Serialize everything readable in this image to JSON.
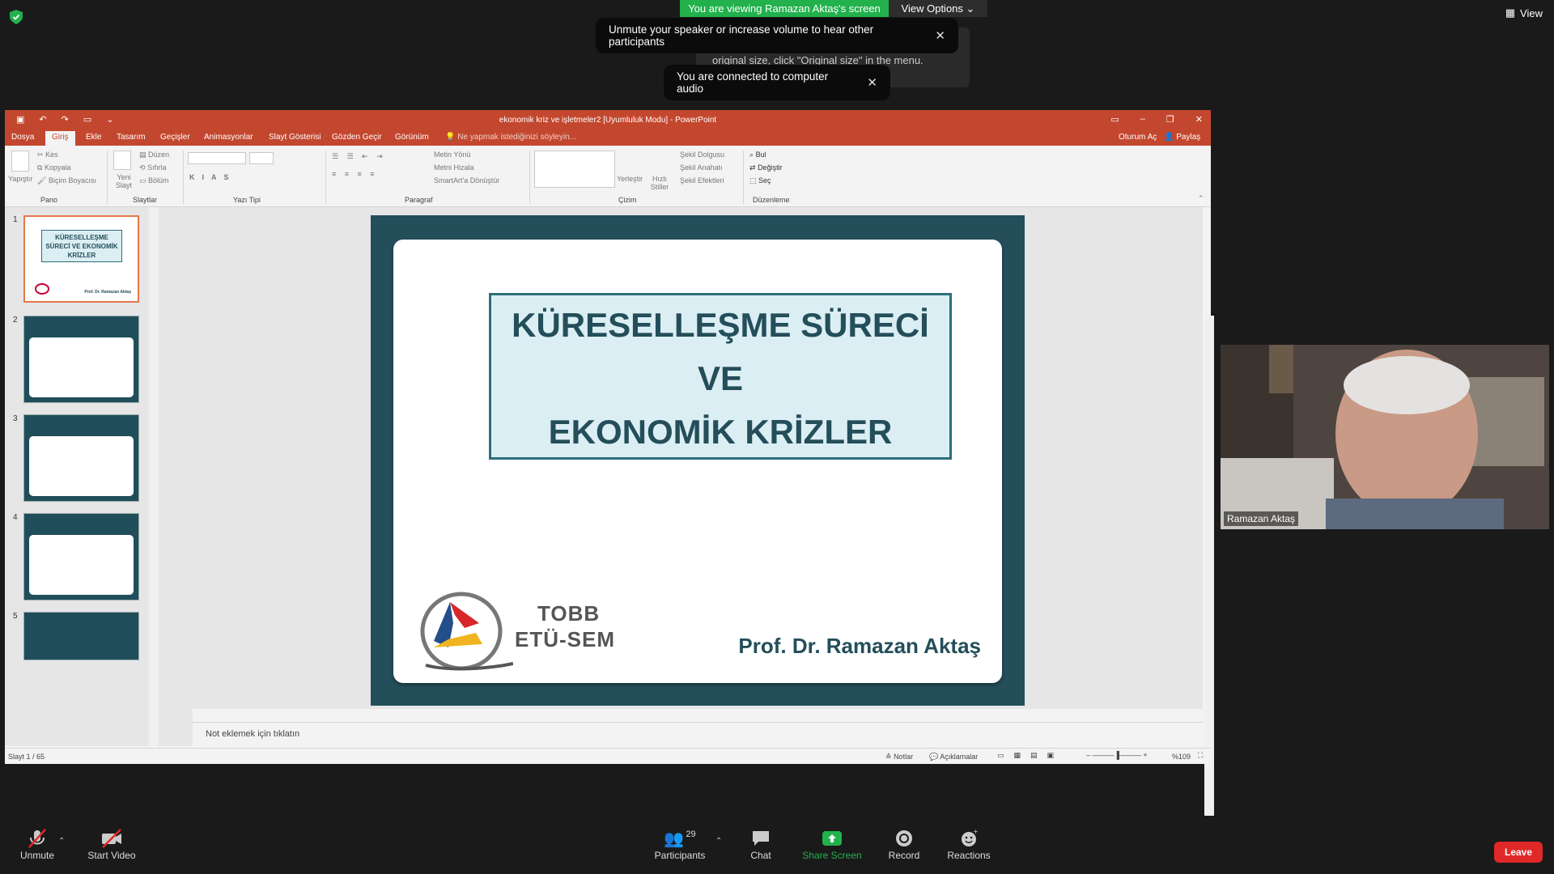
{
  "zoom": {
    "viewing_banner": "You are viewing Ramazan Aktaş's screen",
    "view_options": "View Options",
    "view_button": "View",
    "toast_unmute": "Unmute your speaker or increase volume to hear other participants",
    "toast_audio": "You are connected to computer audio",
    "toast_behind": "The shared content is fit to your screen. To see the original size, click \"Original size\" in the menu.",
    "participant_name": "Ramazan Aktaş",
    "toolbar": {
      "unmute": "Unmute",
      "start_video": "Start Video",
      "participants": "Participants",
      "participants_count": "29",
      "chat": "Chat",
      "share_screen": "Share Screen",
      "record": "Record",
      "reactions": "Reactions",
      "leave": "Leave"
    },
    "colors": {
      "green": "#22b14c",
      "leave_red": "#e02828",
      "ppt_red": "#c3472e"
    }
  },
  "ppt": {
    "window_title": "ekonomik kriz ve işletmeler2 [Uyumluluk Modu] - PowerPoint",
    "tabs": [
      "Dosya",
      "Giriş",
      "Ekle",
      "Tasarım",
      "Geçişler",
      "Animasyonlar",
      "Slayt Gösterisi",
      "Gözden Geçir",
      "Görünüm"
    ],
    "tell_me": "Ne yapmak istediğinizi söyleyin...",
    "sign_in": "Oturum Aç",
    "share": "Paylaş",
    "ribbon": {
      "paste": "Yapıştır",
      "cut": "Kes",
      "copy": "Kopyala",
      "format_painter": "Biçim Boyacısı",
      "new_slide": "Yeni Slayt",
      "layout": "Düzen",
      "reset": "Sıfırla",
      "section": "Bölüm",
      "text_direction": "Metin Yönü",
      "align_text": "Metni Hizala",
      "smartart": "SmartArt'a Dönüştür",
      "arrange": "Yerleştir",
      "quick_styles": "Hızlı Stiller",
      "shape_fill": "Şekil Dolgusu",
      "shape_outline": "Şekil Anahatı",
      "shape_effects": "Şekil Efektleri",
      "find": "Bul",
      "replace": "Değiştir",
      "select": "Seç",
      "group_labels": {
        "pano": "Pano",
        "slaytlar": "Slaytlar",
        "yazi_tipi": "Yazı Tipi",
        "paragraf": "Paragraf",
        "cizim": "Çizim",
        "duzenleme": "Düzenleme"
      }
    },
    "thumb_numbers": [
      "1",
      "2",
      "3",
      "4",
      "5"
    ],
    "thumb1_title": "KÜRESELLEŞME SÜRECİ VE EKONOMİK KRİZLER",
    "thumb1_author": "Prof. Dr. Ramazan Aktaş",
    "slide": {
      "title_line1": "KÜRESELLEŞME SÜRECİ",
      "title_line2": "VE",
      "title_line3": "EKONOMİK KRİZLER",
      "logo_line1": "TOBB",
      "logo_line2": "ETÜ-SEM",
      "author": "Prof. Dr. Ramazan Aktaş"
    },
    "notes_placeholder": "Not eklemek için tıklatın",
    "status": {
      "slide_counter": "Slayt 1 / 65",
      "notes": "Notlar",
      "comments": "Açıklamalar",
      "zoom": "%109"
    }
  }
}
